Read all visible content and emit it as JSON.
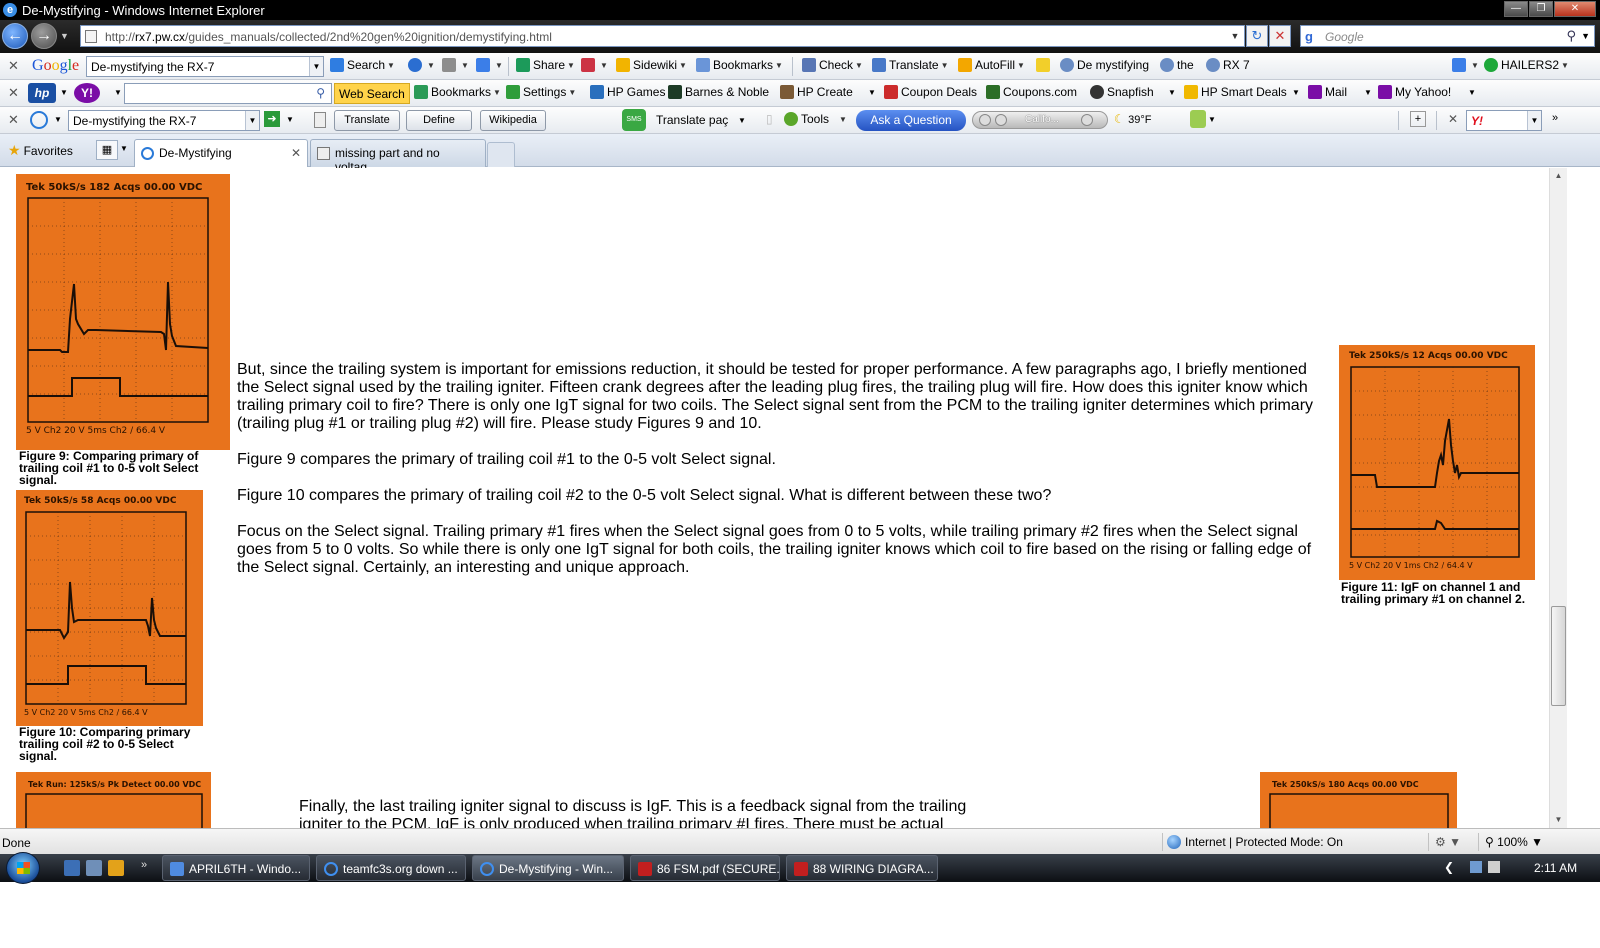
{
  "window": {
    "title": "De-Mystifying - Windows Internet Explorer"
  },
  "address_bar": {
    "url_prefix": "http://",
    "url_host": "rx7.pw.cx",
    "url_path": "/guides_manuals/collected/2nd%20gen%20ignition/demystifying.html",
    "search_placeholder": "Google"
  },
  "google_toolbar": {
    "logo": "Google",
    "search_value": "De-mystifying the RX-7",
    "items": {
      "search": "Search",
      "share": "Share",
      "sidewiki": "Sidewiki",
      "bookmarks": "Bookmarks",
      "check": "Check",
      "translate": "Translate",
      "autofill": "AutoFill",
      "demystifying": "De mystifying",
      "the": "the",
      "rx7": "RX 7",
      "account": "HAILERS2"
    }
  },
  "hp_toolbar": {
    "web_search": "Web Search",
    "bookmarks": "Bookmarks",
    "settings": "Settings",
    "hp_games": "HP Games",
    "barnes_noble": "Barnes & Noble",
    "hp_create": "HP Create",
    "coupon_deals": "Coupon Deals",
    "coupons_com": "Coupons.com",
    "snapfish": "Snapfish",
    "hp_smart_deals": "HP Smart Deals",
    "mail": "Mail",
    "my_yahoo": "My Yahoo!"
  },
  "ask_toolbar": {
    "search_value": "De-mystifying the RX-7",
    "translate": "Translate",
    "define": "Define",
    "wikipedia": "Wikipedia",
    "translate_page": "Translate paç",
    "tools": "Tools",
    "ask_question": "Ask a Question",
    "radio_station": "Califo...",
    "weather": "39°F",
    "yahoo_logo": "Y!"
  },
  "tabs": {
    "favorites": "Favorites",
    "items": [
      {
        "label": "De-Mystifying"
      },
      {
        "label": "missing part and no voltag..."
      }
    ]
  },
  "page": {
    "fig9_caption": "Figure 9: Comparing primary of trailing coil #1 to 0-5 volt Select signal.",
    "fig10_caption": "Figure 10: Comparing primary trailing coil #2 to 0-5 Select signal.",
    "fig11_caption": "Figure 11: IgF on channel 1 and trailing primary #1 on channel 2.",
    "paragraphs": [
      "But, since the trailing system is important for emissions reduction, it should be tested for proper performance. A few paragraphs ago, I briefly mentioned the Select signal used by the trailing igniter. Fifteen crank degrees after the leading plug fires, the trailing plug will fire. How does this igniter know which trailing primary coil to fire? There is only one IgT signal for two coils. The Select signal sent from the PCM to the trailing igniter determines which primary (trailing plug #1 or trailing plug #2) will fire. Please study Figures 9 and 10.",
      "Figure 9 compares the primary of trailing coil #1 to the 0-5 volt Select signal.",
      "Figure 10 compares the primary of trailing coil #2 to the 0-5 volt Select signal. What is different between these two?",
      "Focus on the Select signal. Trailing primary #1 fires when the Select signal goes from 0 to 5 volts, while trailing primary #2 fires when the Select signal goes from 5 to 0 volts. So while there is only one IgT signal for both coils, the trailing igniter knows which coil to fire based on the rising or falling edge of the Select signal. Certainly, an interesting and unique approach."
    ],
    "final_paragraph": "Finally, the last trailing igniter signal to discuss is IgF. This is a feedback signal from the trailing igniter to the PCM. IgF is only produced when trailing primary #I fires. There must be actual primary firing!",
    "scopes": {
      "fig9_header": "Tek 50kS/s   182 Acqs    00.00 VDC",
      "fig9_footer": "5 V   Ch2  20 V    5ms  Ch2 /    66.4 V",
      "fig10_header": "Tek 50kS/s   58 Acqs    00.00 VDC",
      "fig10_footer": "5 V   Ch2  20 V    5ms  Ch2 /   66.4 V",
      "fig11_header": "Tek 250kS/s   12 Acqs    00.00 VDC",
      "fig11_footer": "5 V   Ch2  20 V    1ms  Ch2 /   64.4 V",
      "fig12_header": "Tek Run: 125kS/s  Pk Detect     00.00 VDC",
      "fig13_header": "Tek 250kS/s   180 Acqs    00.00 VDC"
    }
  },
  "status_bar": {
    "status": "Done",
    "zone": "Internet | Protected Mode: On",
    "zoom": "100%"
  },
  "taskbar": {
    "tasks": [
      {
        "label": "APRIL6TH - Windo..."
      },
      {
        "label": "teamfc3s.org down ..."
      },
      {
        "label": "De-Mystifying - Win..."
      },
      {
        "label": "86 FSM.pdf (SECURE..."
      },
      {
        "label": "88 WIRING DIAGRA..."
      }
    ],
    "clock": "2:11 AM"
  },
  "colors": {
    "scope_orange": "#e8731c",
    "trace": "#1a0f08",
    "ie_blue": "#1b57b8"
  }
}
